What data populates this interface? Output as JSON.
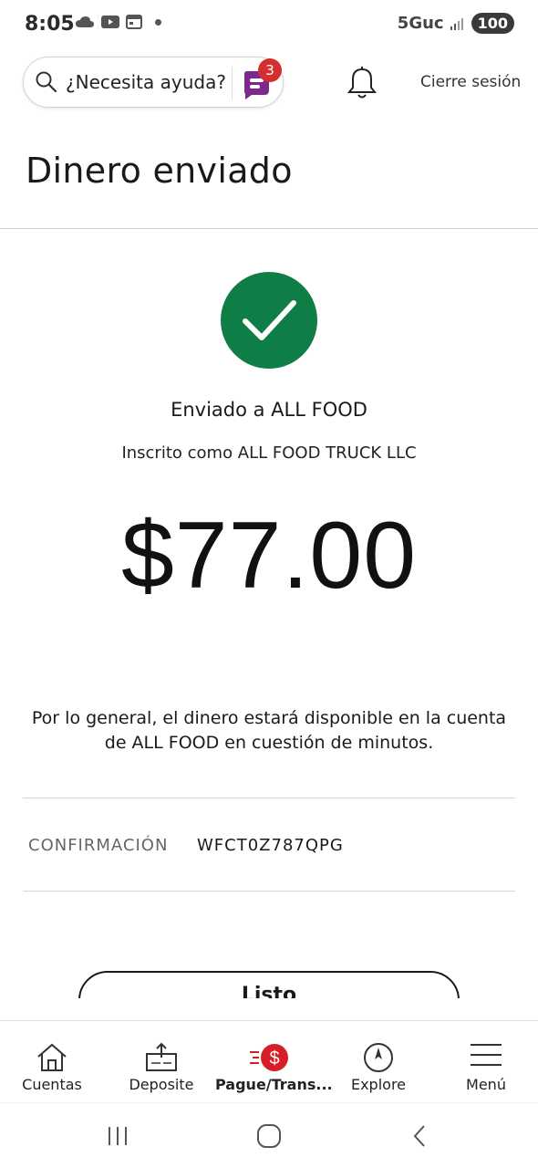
{
  "status_bar": {
    "time": "8:05",
    "network": "5Guc",
    "battery": "100"
  },
  "header": {
    "help_placeholder": "¿Necesita ayuda?",
    "assistant_badge_count": "3",
    "signout_label": "Cierre sesión"
  },
  "page": {
    "title": "Dinero enviado"
  },
  "confirmation": {
    "sent_to": "Enviado a ALL FOOD",
    "registered_as": "Inscrito como ALL FOOD TRUCK LLC",
    "amount": "$77.00",
    "availability_message": "Por lo general, el dinero estará disponible en la cuenta de ALL FOOD en cuestión de minutos.",
    "confirmation_label": "CONFIRMACIÓN",
    "confirmation_number": "WFCT0Z787QPG",
    "done_label": "Listo"
  },
  "bottom_nav": {
    "items": [
      {
        "label": "Cuentas",
        "icon": "house-icon"
      },
      {
        "label": "Deposite",
        "icon": "deposit-icon"
      },
      {
        "label": "Pague/Trans...",
        "icon": "pay-transfer-icon",
        "active": true
      },
      {
        "label": "Explore",
        "icon": "compass-icon"
      },
      {
        "label": "Menú",
        "icon": "hamburger-menu-icon"
      }
    ]
  },
  "colors": {
    "success_green": "#0f7d46",
    "badge_red": "#d32f2f",
    "assistant_purple": "#7b2a8c",
    "pay_red": "#d71e28"
  }
}
